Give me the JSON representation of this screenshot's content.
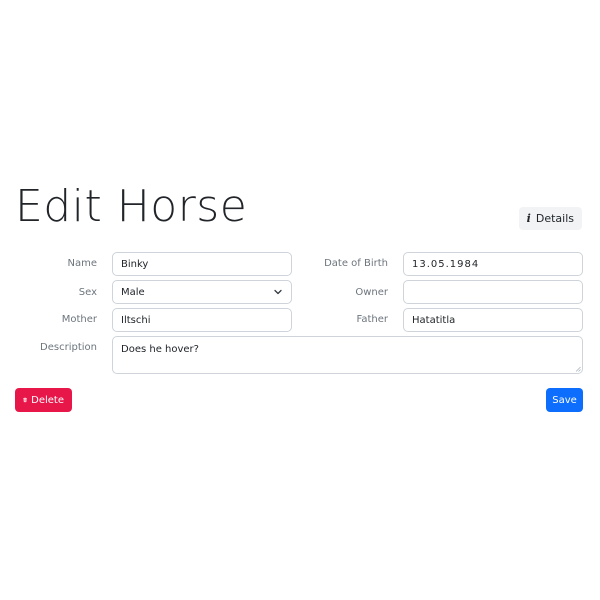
{
  "page": {
    "title": "Edit Horse",
    "details_label": "Details"
  },
  "form": {
    "name": {
      "label": "Name",
      "value": "Binky"
    },
    "date_of_birth": {
      "label": "Date of Birth",
      "value": "13.05.1984"
    },
    "sex": {
      "label": "Sex",
      "value": "Male"
    },
    "owner": {
      "label": "Owner",
      "value": ""
    },
    "mother": {
      "label": "Mother",
      "value": "Iltschi"
    },
    "father": {
      "label": "Father",
      "value": "Hatatitla"
    },
    "description": {
      "label": "Description",
      "value": "Does he hover?"
    }
  },
  "actions": {
    "delete_label": "Delete",
    "save_label": "Save"
  },
  "colors": {
    "danger": "#e8174a",
    "primary": "#0d6efd"
  },
  "icons": {
    "details": "info-icon",
    "delete": "trash-icon",
    "sex_select": "chevron-down-icon"
  }
}
